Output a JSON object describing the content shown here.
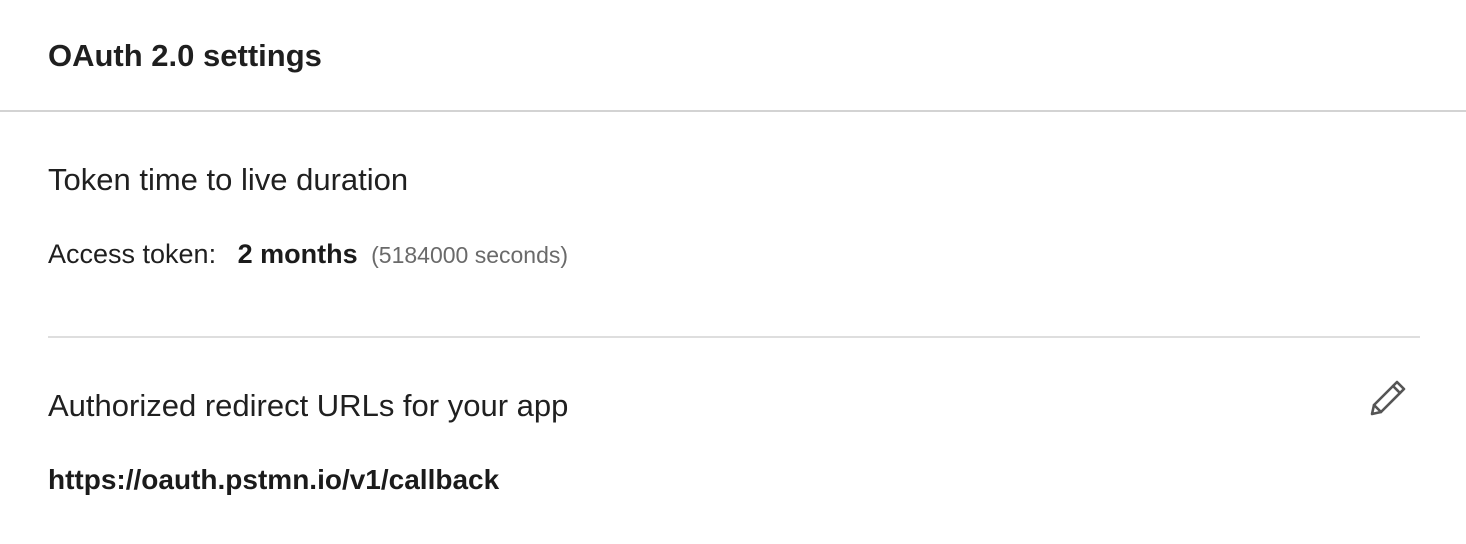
{
  "header": {
    "title": "OAuth 2.0 settings"
  },
  "token_section": {
    "heading": "Token time to live duration",
    "access_label": "Access token:",
    "access_value": "2 months",
    "access_seconds": "(5184000 seconds)"
  },
  "redirect_section": {
    "heading": "Authorized redirect URLs for your app",
    "url": "https://oauth.pstmn.io/v1/callback",
    "edit_icon": "pencil-icon"
  },
  "colors": {
    "text": "#1b1b1b",
    "muted": "#6a6a6a",
    "divider": "#d3d3d3",
    "icon": "#555555"
  }
}
